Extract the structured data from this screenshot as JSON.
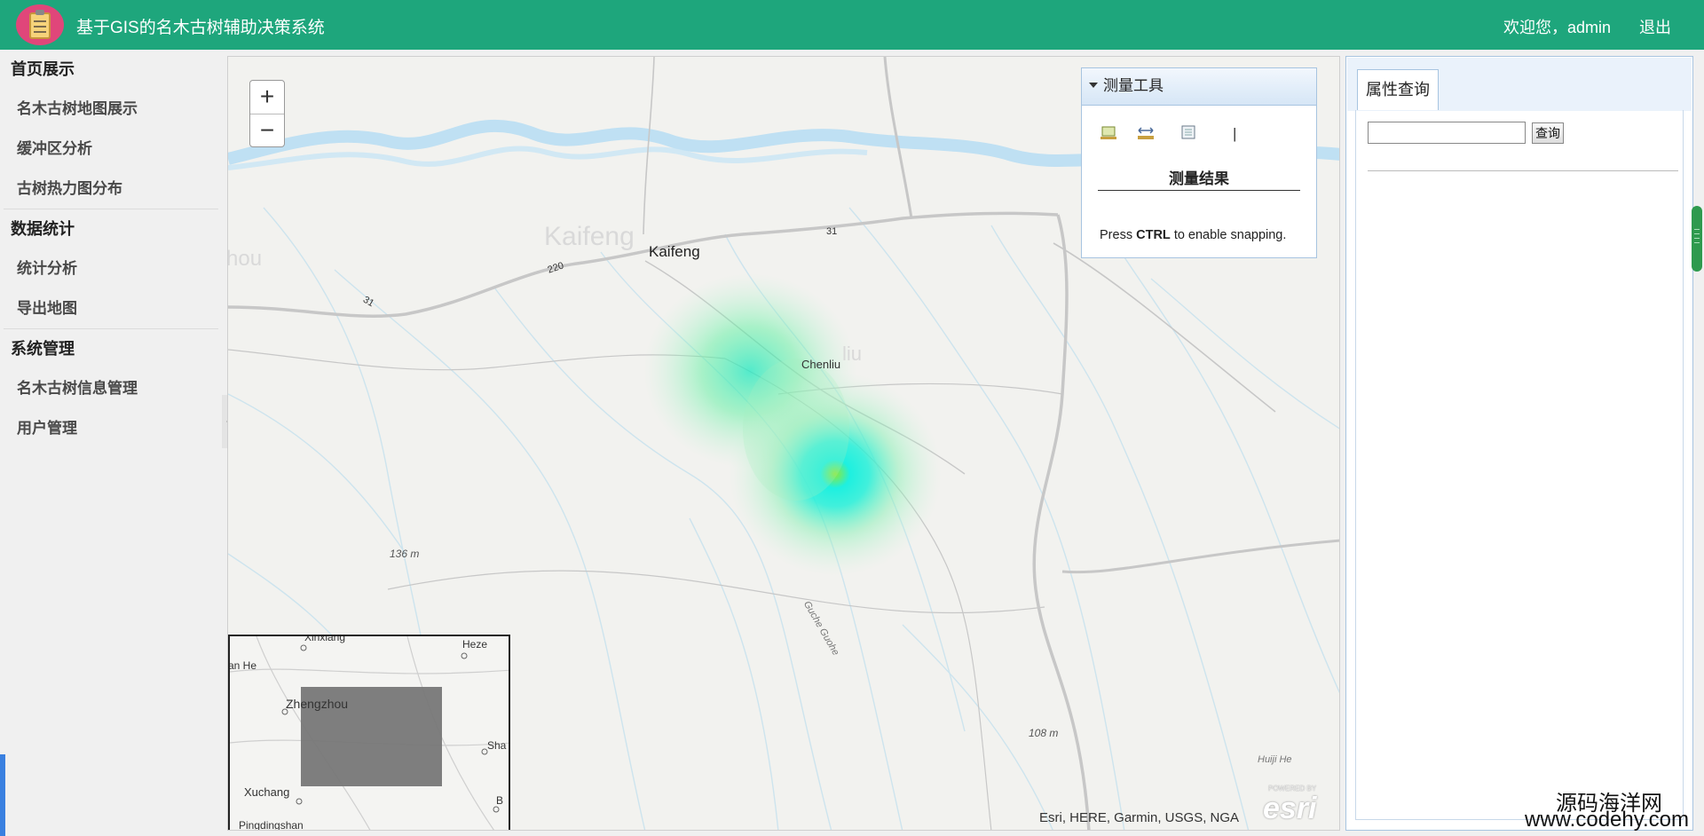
{
  "header": {
    "title": "基于GIS的名木古树辅助决策系统",
    "welcome": "欢迎您，admin",
    "logout": "退出",
    "logo_icon": "clipboard-icon"
  },
  "sidebar": {
    "groups": [
      {
        "label": "首页展示",
        "items": [
          "名木古树地图展示",
          "缓冲区分析",
          "古树热力图分布"
        ]
      },
      {
        "label": "数据统计",
        "items": [
          "统计分析",
          "导出地图"
        ]
      },
      {
        "label": "系统管理",
        "items": [
          "名木古树信息管理",
          "用户管理"
        ]
      }
    ]
  },
  "map": {
    "zoom_in": "+",
    "zoom_out": "−",
    "labels": {
      "kaifeng_faded": "Kaifeng",
      "kaifeng": "Kaifeng",
      "chenliu": "Chenliu",
      "road_220": "220",
      "road_31a": "31",
      "road_31b": "31",
      "elev_136": "136 m",
      "elev_108": "108 m",
      "river_guche": "Guche Guohe",
      "river_huiji": "Huiji He",
      "partial_zhou": "hou",
      "partial_liu": "liu"
    },
    "attribution": "Esri, HERE, Garmin, USGS, NGA",
    "esri_powered": "POWERED BY",
    "esri_logo": "esri",
    "heat_colors": {
      "core": "#8ee83a",
      "mid": "#1ef0e0",
      "outer": "#6ef0a0"
    }
  },
  "overview": {
    "labels": {
      "xinxiang": "Xinxiang",
      "heze": "Heze",
      "zhengzhou": "Zhengzhou",
      "xuchang": "Xuchang",
      "pingdingshan": "Pingdingshan",
      "sha": "Sha",
      "b": "B",
      "anhe": "an He"
    }
  },
  "measure": {
    "title": "测量工具",
    "result_label": "测量结果",
    "hint_prefix": "Press",
    "hint_key": "CTRL",
    "hint_suffix": "to enable snapping.",
    "separator": "|",
    "tools": [
      "area-measure-icon",
      "distance-measure-icon",
      "location-measure-icon"
    ]
  },
  "right_panel": {
    "tab": "属性查询",
    "query_input_value": "",
    "query_button": "查询"
  },
  "watermark": {
    "line1": "源码海洋网",
    "line2": "www.codehy.com"
  }
}
